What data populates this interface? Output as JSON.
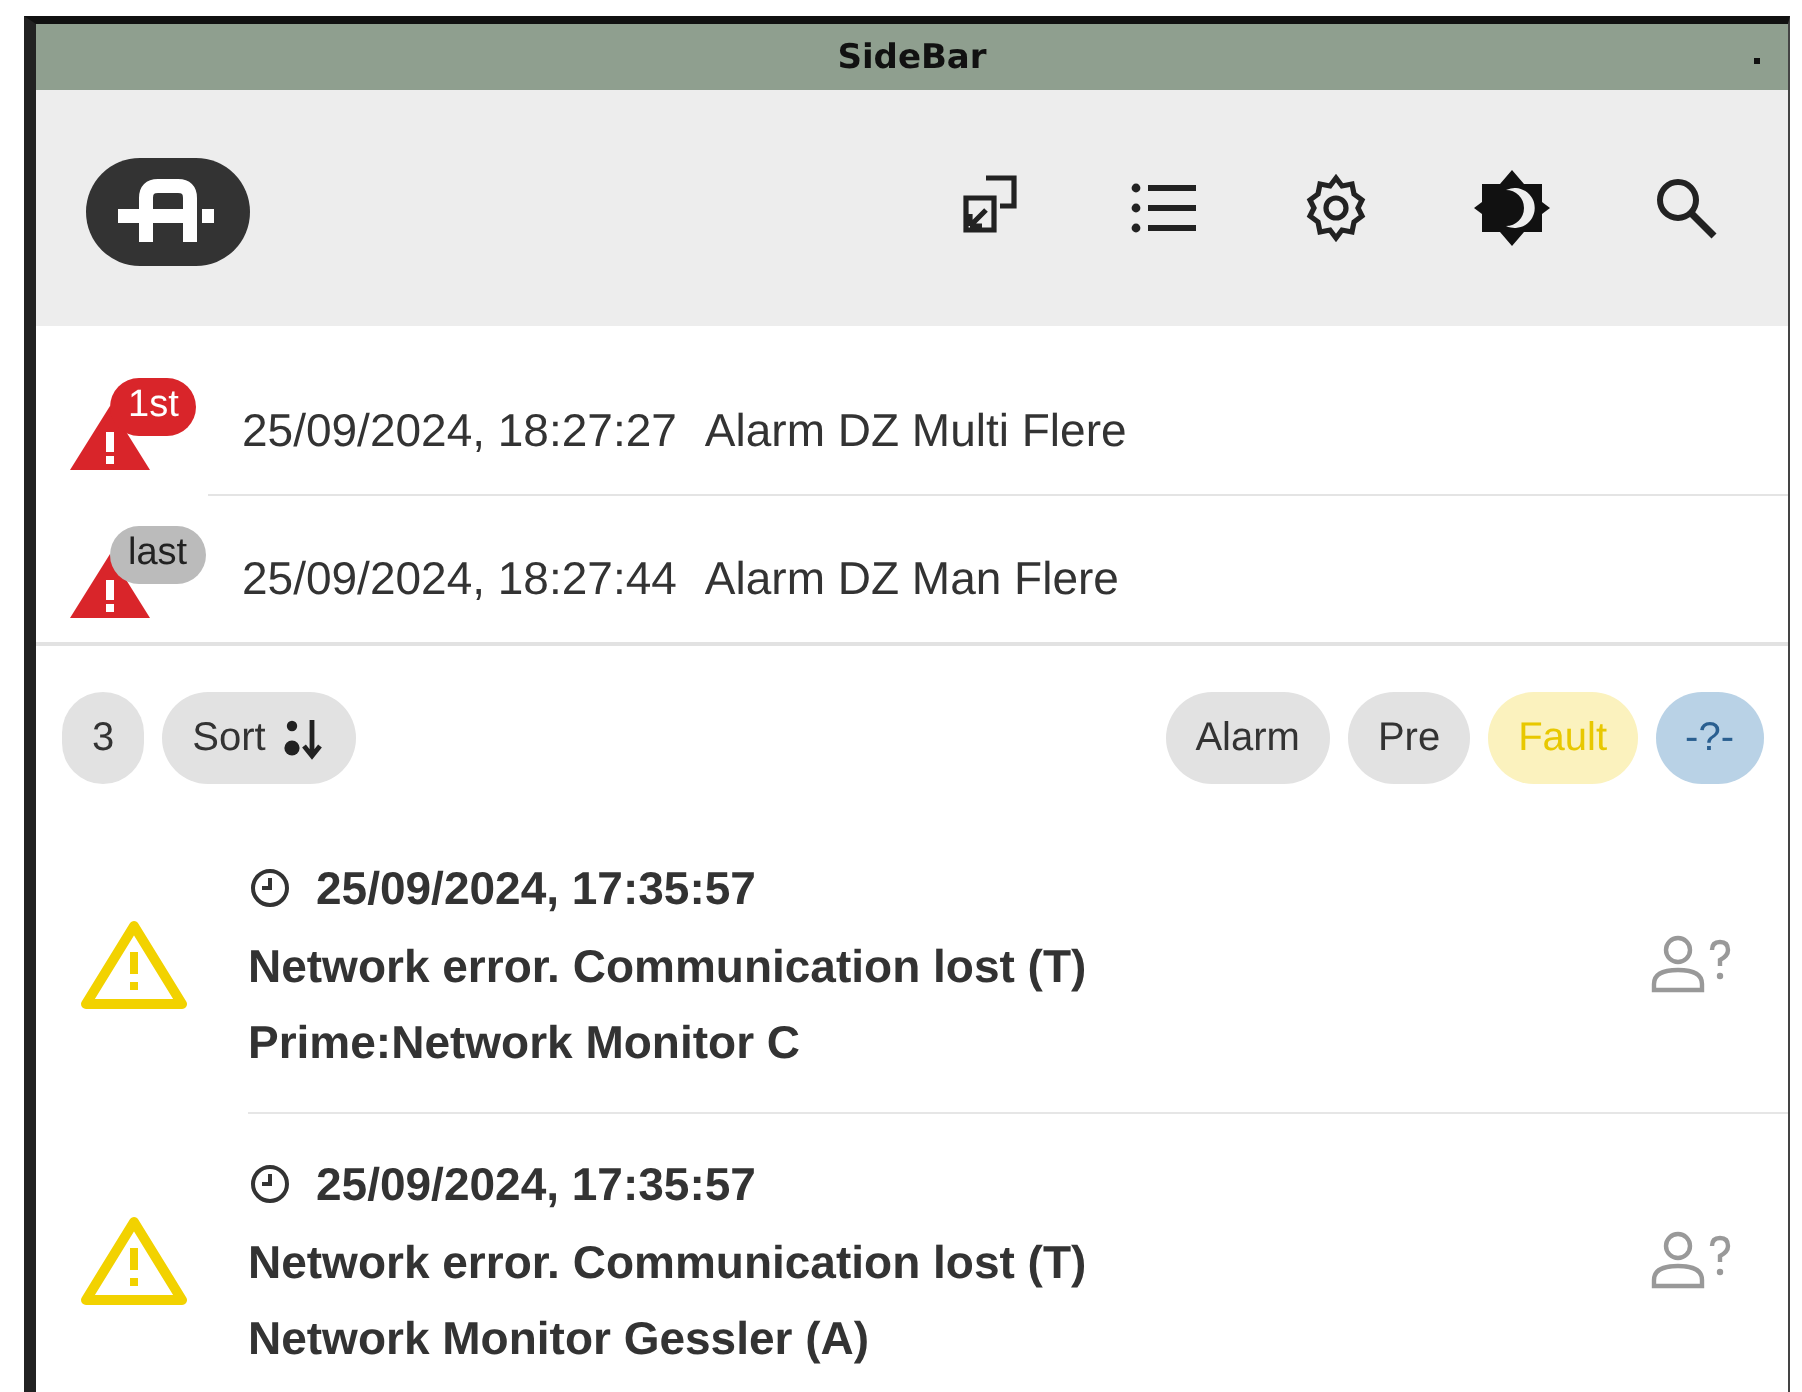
{
  "window": {
    "title": "SideBar"
  },
  "top_alarms": [
    {
      "badge": "1st",
      "kind": "first",
      "time": "25/09/2024, 18:27:27",
      "text": "Alarm DZ Multi Flere"
    },
    {
      "badge": "last",
      "kind": "last",
      "time": "25/09/2024, 18:27:44",
      "text": "Alarm DZ Man Flere"
    }
  ],
  "toolbar": {
    "count": "3",
    "sort": "Sort",
    "filters": [
      {
        "label": "Alarm",
        "kind": "alarm"
      },
      {
        "label": "Pre",
        "kind": "pre"
      },
      {
        "label": "Fault",
        "kind": "fault"
      },
      {
        "label": "-?-",
        "kind": "unknown"
      }
    ]
  },
  "events": [
    {
      "time": "25/09/2024, 17:35:57",
      "title": "Network error. Communication lost (T)",
      "source": "Prime:Network Monitor C"
    },
    {
      "time": "25/09/2024, 17:35:57",
      "title": "Network error. Communication lost (T)",
      "source": "Network Monitor Gessler (A)"
    }
  ]
}
